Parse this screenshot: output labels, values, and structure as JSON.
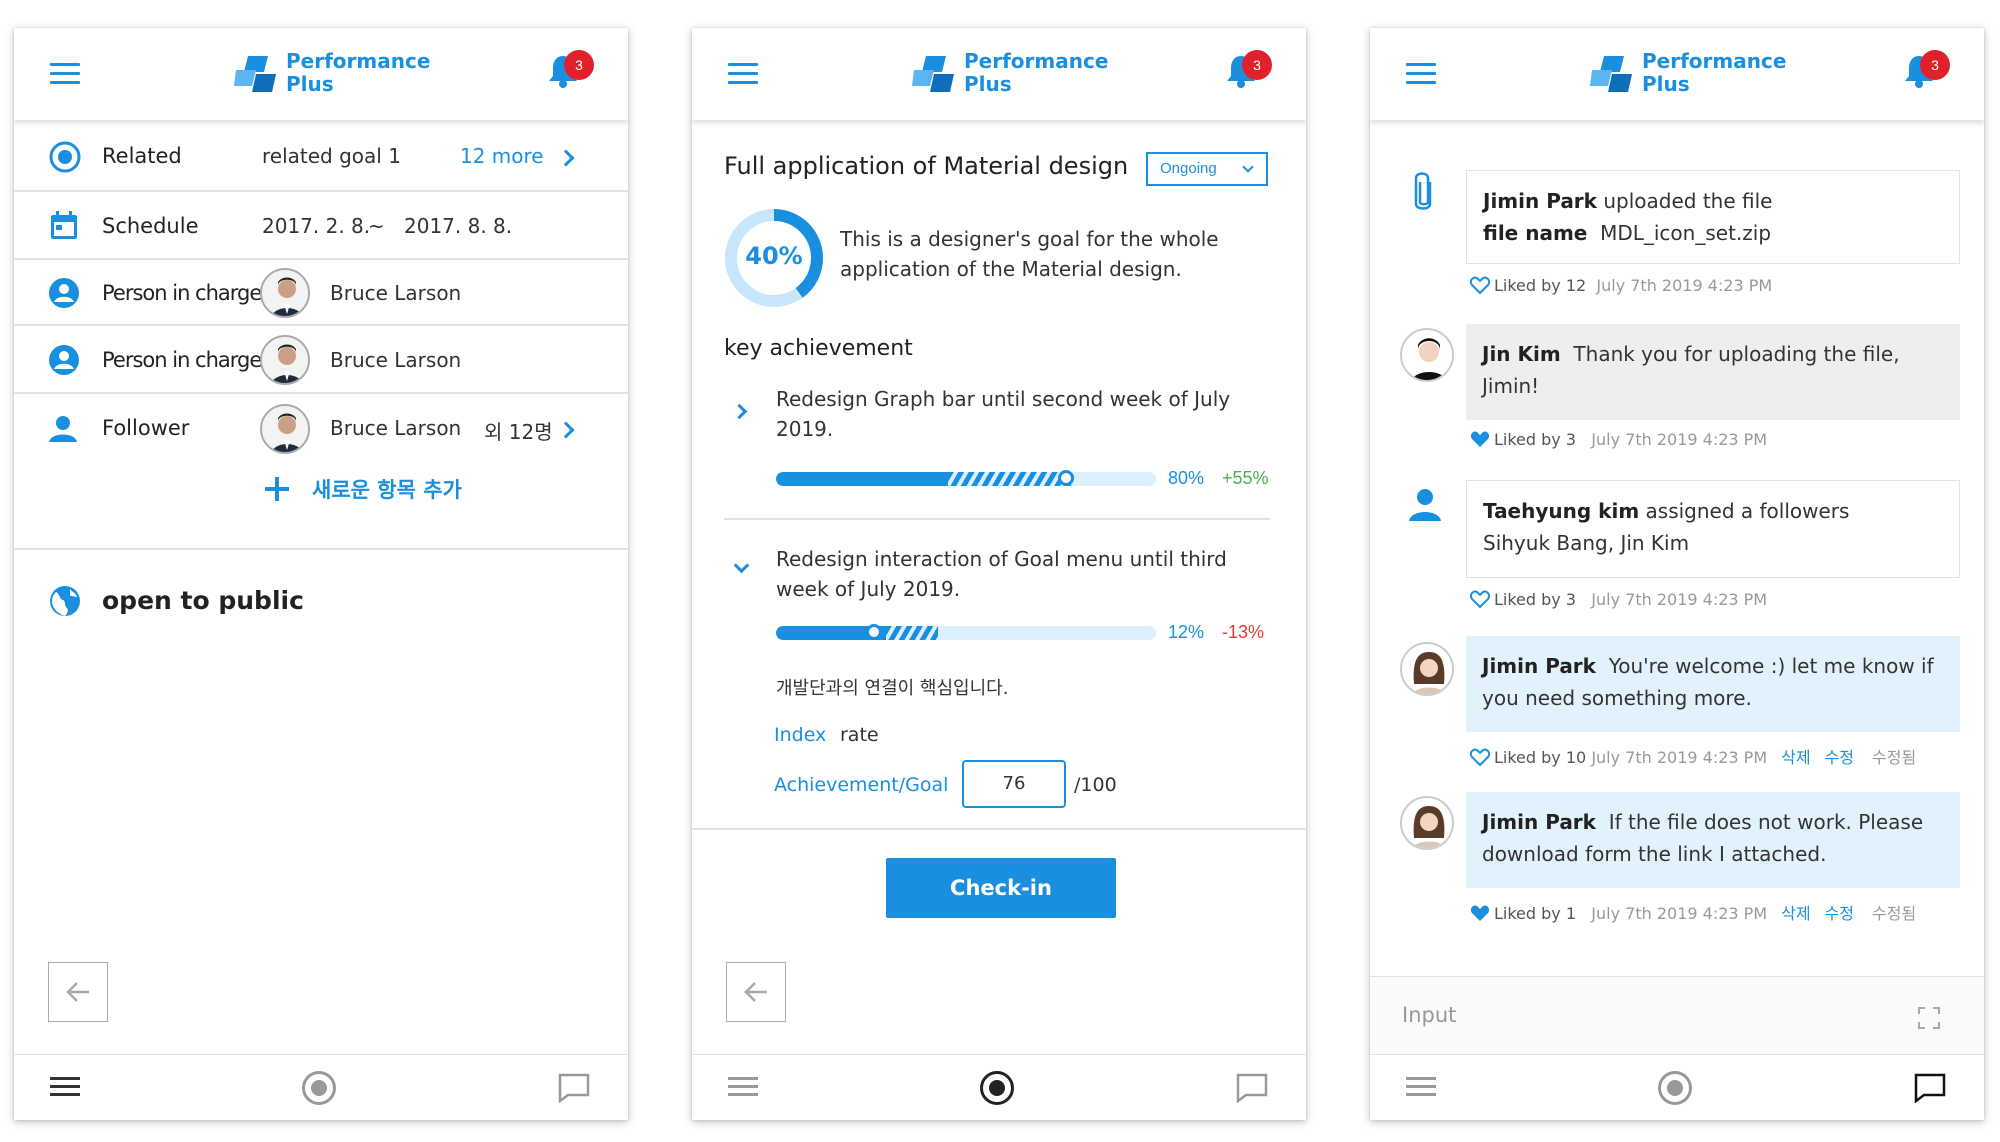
{
  "brand": {
    "line1": "Performance",
    "line2": "Plus",
    "notification_count": "3",
    "accent_color": "#1a8fe0",
    "badge_color": "#e0202b"
  },
  "panel1": {
    "related": {
      "label": "Related",
      "value": "related goal 1",
      "more": "12 more"
    },
    "schedule": {
      "label": "Schedule",
      "start": "2017. 2. 8.",
      "sep": "~",
      "end": "2017. 8. 8."
    },
    "person_in_charge": [
      {
        "label": "Person in charge",
        "name": "Bruce Larson"
      },
      {
        "label": "Person in charge",
        "name": "Bruce Larson"
      }
    ],
    "follower": {
      "label": "Follower",
      "name": "Bruce Larson",
      "extra": "외 12명"
    },
    "add_item": "새로운 항목 추가",
    "public": {
      "label": "open to public"
    }
  },
  "panel2": {
    "title": "Full application of Material design",
    "status": "Ongoing",
    "progress": {
      "value": "40%",
      "fraction": 0.4
    },
    "description": "This is a designer's goal for the whole application of the Material design.",
    "key_heading": "key achievement",
    "achievements": [
      {
        "text": "Redesign Graph bar until second week of July 2019.",
        "percent": "80%",
        "delta": "+55%",
        "delta_color": "#4caf50",
        "progress": 0.8
      },
      {
        "text": "Redesign interaction of Goal menu until third week of July 2019.",
        "percent": "12%",
        "delta": "-13%",
        "delta_color": "#e53935",
        "progress": 0.12
      }
    ],
    "note": "개발단과의 연결이 핵심입니다.",
    "index_label": "Index",
    "index_value": "rate",
    "ag_label": "Achievement/Goal",
    "ag_value": "76",
    "ag_max": "/100",
    "checkin": "Check-in"
  },
  "panel3": {
    "feed": [
      {
        "author": "Jimin Park",
        "text": " uploaded the file",
        "file_label": "file name",
        "file": "MDL_icon_set.zip",
        "liked": "Liked by 12",
        "time": "July 7th 2019 4:23 PM"
      },
      {
        "author": "Jin Kim",
        "text": "Thank you for uploading the file, Jimin!",
        "liked": "Liked by 3",
        "time": "July 7th 2019 4:23 PM"
      },
      {
        "author": "Taehyung kim",
        "text": " assigned a followers",
        "text2": "Sihyuk Bang, Jin Kim",
        "liked": "Liked by 3",
        "time": "July 7th 2019 4:23 PM"
      },
      {
        "author": "Jimin Park",
        "text": "You're welcome :) let me know if you need something more.",
        "liked": "Liked by 10",
        "time": "July 7th 2019 4:23 PM",
        "delete": "삭제",
        "edit": "수정",
        "edited": "수정됨"
      },
      {
        "author": "Jimin Park",
        "text": "If the file does not work. Please download form the link I attached.",
        "liked": "Liked by 1",
        "time": "July 7th 2019 4:23 PM",
        "delete": "삭제",
        "edit": "수정",
        "edited": "수정됨"
      }
    ],
    "input_placeholder": "Input"
  }
}
